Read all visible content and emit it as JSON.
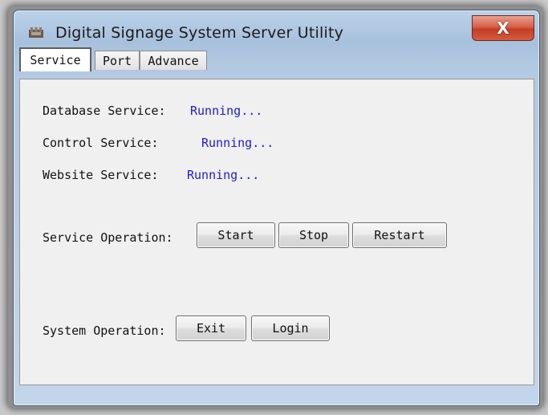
{
  "window": {
    "title": "Digital Signage System Server Utility",
    "close_label": "X"
  },
  "tabs": [
    {
      "label": "Service",
      "active": true
    },
    {
      "label": "Port",
      "active": false
    },
    {
      "label": "Advance",
      "active": false
    }
  ],
  "service_tab": {
    "database_label": "Database Service:",
    "database_status": "Running...",
    "control_label": "Control Service:",
    "control_status": "Running...",
    "website_label": "Website Service:",
    "website_status": "Running...",
    "service_operation_label": "Service Operation:",
    "start_label": "Start",
    "stop_label": "Stop",
    "restart_label": "Restart",
    "system_operation_label": "System Operation:",
    "exit_label": "Exit",
    "login_label": "Login"
  },
  "colors": {
    "status_text": "#1b1bd6",
    "close_button": "#c23d24"
  }
}
